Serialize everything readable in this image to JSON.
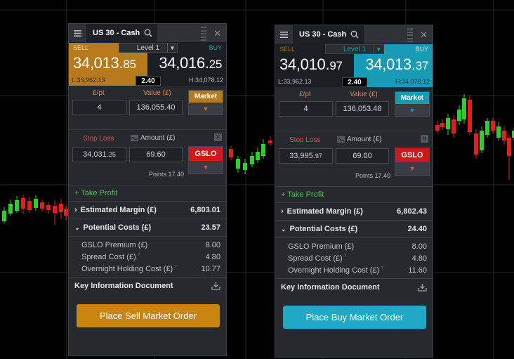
{
  "colors": {
    "sell": "#b8791c",
    "buy": "#189bb4",
    "sell_button": "#c8860f",
    "buy_button": "#1fa9c4",
    "market_button_sell": "#b8791c",
    "market_button_buy": "#189bb4",
    "gslo": "#cc1a1a",
    "take_profit": "#4cc24c",
    "stop_loss_label": "#e04b4b",
    "candle_up": "#2bd02b",
    "candle_down": "#e01f1f"
  },
  "icons": {
    "menu": "hamburger-menu",
    "search": "magnifier",
    "close": "x",
    "download": "tray-download",
    "gslo_toggle": "wave",
    "chevron": "chevron-down"
  },
  "sell_ticket": {
    "market": "US 30 - Cash",
    "side_label_left": "SELL",
    "side_label_right": "BUY",
    "level": "Level 1",
    "sell_price_main": "34,013.",
    "sell_price_small": "85",
    "buy_price_main": "34,016.",
    "buy_price_small": "25",
    "low": "L:33,962.13",
    "high": "H:34,078.12",
    "spread": "2.40",
    "per_pt_label": "£/pt",
    "value_label": "Value (£)",
    "per_pt": "4",
    "value": "136,055.40",
    "market_btn": "Market",
    "stop_loss_label": "Stop Loss",
    "amount_label": "Amount (£)",
    "stop_price_main": "34,031.",
    "stop_price_small": "25",
    "amount": "69.60",
    "gslo": "GSLO",
    "points": "Points 17.40",
    "take_profit": "+ Take Profit",
    "margin_label": "Estimated Margin (£)",
    "margin_value": "6,803.01",
    "costs_label": "Potential Costs (£)",
    "costs_value": "23.57",
    "gslo_premium_label": "GSLO Premium (£)",
    "gslo_premium": "8.00",
    "spread_cost_label": "Spread Cost (£)",
    "spread_cost": "4.80",
    "holding_label": "Overnight Holding Cost (£)",
    "holding": "10.77",
    "kid_label": "Key Information Document",
    "order_button": "Place Sell Market Order"
  },
  "buy_ticket": {
    "market": "US 30 - Cash",
    "side_label_left": "SELL",
    "side_label_right": "BUY",
    "level": "Level 1",
    "sell_price_main": "34,010.",
    "sell_price_small": "97",
    "buy_price_main": "34,013.",
    "buy_price_small": "37",
    "low": "L:33,962.13",
    "high": "H:34,078.12",
    "spread": "2.40",
    "per_pt_label": "£/pt",
    "value_label": "Value (£)",
    "per_pt": "4",
    "value": "136,053.48",
    "market_btn": "Market",
    "stop_loss_label": "Stop Loss",
    "amount_label": "Amount (£)",
    "stop_price_main": "33,995.",
    "stop_price_small": "97",
    "amount": "69.60",
    "gslo": "GSLO",
    "points": "Points 17.40",
    "take_profit": "+ Take Profit",
    "margin_label": "Estimated Margin (£)",
    "margin_value": "6,802.43",
    "costs_label": "Potential Costs (£)",
    "costs_value": "24.40",
    "gslo_premium_label": "GSLO Premium (£)",
    "gslo_premium": "8.00",
    "spread_cost_label": "Spread Cost (£)",
    "spread_cost": "4.80",
    "holding_label": "Overnight Holding Cost (£)",
    "holding": "11.60",
    "kid_label": "Key Information Document",
    "order_button": "Place Buy Market Order"
  }
}
